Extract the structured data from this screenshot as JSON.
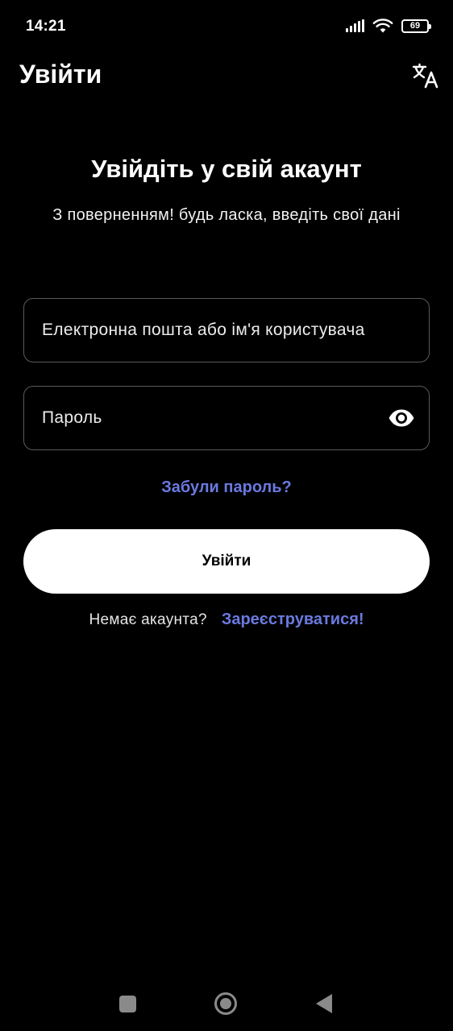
{
  "status_bar": {
    "time": "14:21",
    "battery_level": "69",
    "icons": [
      "signal-icon",
      "wifi-icon",
      "battery-icon"
    ]
  },
  "app_bar": {
    "title": "Увійти",
    "translate_icon": "translate-icon"
  },
  "login": {
    "heading": "Увійдіть у свій акаунт",
    "subheading": "З поверненням! будь ласка, введіть свої дані",
    "email_placeholder": "Електронна пошта або ім'я користувача",
    "password_placeholder": "Пароль",
    "password_toggle_icon": "eye-icon",
    "forgot_password": "Забули пароль?",
    "submit_label": "Увійти",
    "no_account_prompt": "Немає акаунта?",
    "register_link": "Зареєструватися!"
  },
  "nav_bar": {
    "icons": [
      "recents-icon",
      "home-icon",
      "back-icon"
    ]
  },
  "colors": {
    "background": "#000000",
    "text": "#ffffff",
    "accent_link": "#6b7ae0",
    "input_border": "#5a5a5a",
    "button_bg": "#ffffff",
    "nav_icon": "#8a8a8a"
  }
}
